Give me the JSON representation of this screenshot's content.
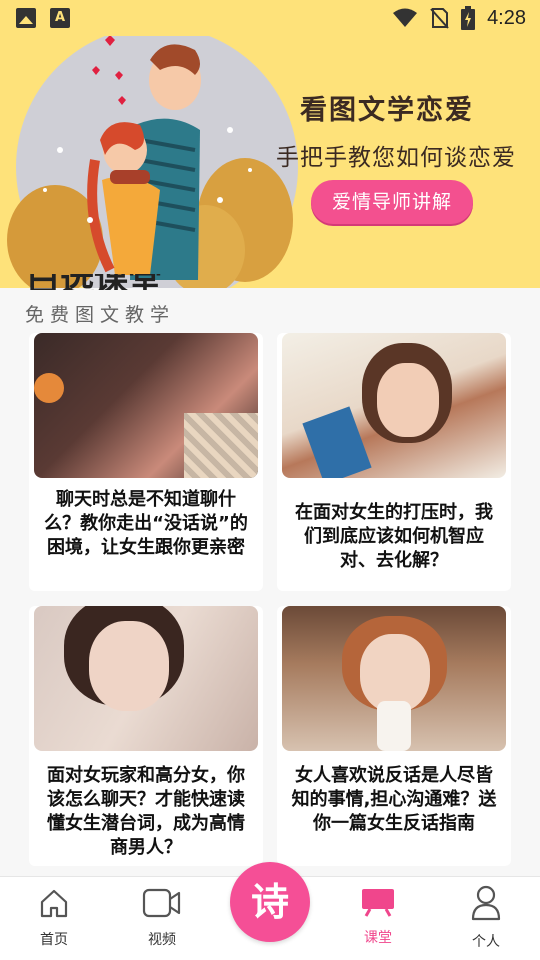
{
  "status_bar": {
    "time": "4:28",
    "icons": [
      "image-icon",
      "font-icon",
      "wifi-icon",
      "no-sim-icon",
      "battery-charging-icon"
    ]
  },
  "banner": {
    "title": "看图文学恋爱",
    "subtitle": "手把手教您如何谈恋爱",
    "button_label": "爱情导师讲解",
    "colors": {
      "background": "#fee27a",
      "button": "#f3508f"
    }
  },
  "section": {
    "title": "白选课堂",
    "subtitle": "免费图文教学"
  },
  "articles": [
    {
      "title": "聊天时总是不知道聊什么？教你走出“没话说”的困境，让女生跟你更亲密",
      "image": "woman-hair-photo"
    },
    {
      "title": "在面对女生的打压时，我们到底应该如何机智应对、去化解？",
      "image": "girl-with-book-photo"
    },
    {
      "title": "面对女玩家和高分女，你该怎么聊天？才能快速读懂女生潜台词，成为高情商男人？",
      "image": "woman-portrait-photo"
    },
    {
      "title": "女人喜欢说反话是人尽皆知的事情,担心沟通难？送你一篇女生反话指南",
      "image": "girl-with-drink-photo"
    }
  ],
  "bottom_nav": {
    "items": [
      {
        "label": "首页",
        "icon": "home-icon"
      },
      {
        "label": "视频",
        "icon": "video-icon"
      },
      {
        "label": "课堂",
        "icon": "classroom-icon",
        "active": true
      },
      {
        "label": "个人",
        "icon": "person-icon"
      }
    ],
    "center_button": "诗",
    "accent_color": "#f0468c"
  }
}
